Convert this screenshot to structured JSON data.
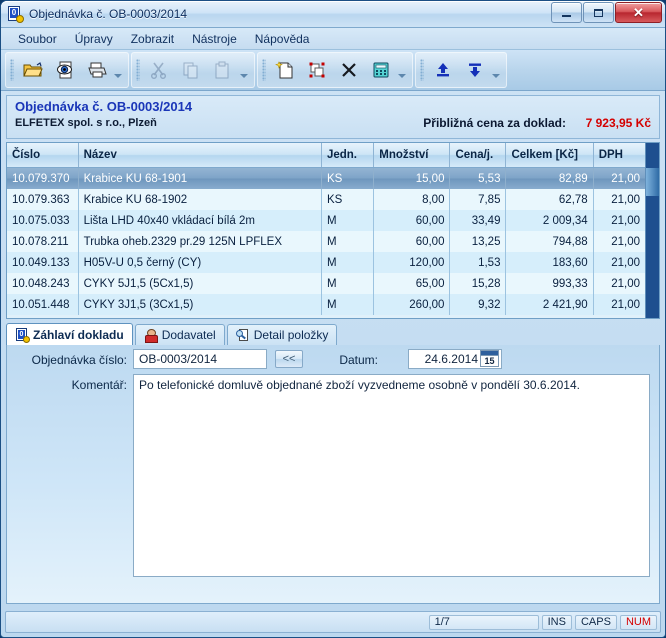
{
  "window": {
    "title": "Objednávka č. OB-0003/2014",
    "icon": "document-key-icon",
    "minimize": "–",
    "maximize": "□",
    "close": "✕"
  },
  "menu": {
    "items": [
      {
        "label": "Soubor"
      },
      {
        "label": "Úpravy"
      },
      {
        "label": "Zobrazit"
      },
      {
        "label": "Nástroje"
      },
      {
        "label": "Nápověda"
      }
    ]
  },
  "toolbar": {
    "groups": [
      {
        "buttons": [
          {
            "name": "open-icon",
            "enabled": true
          },
          {
            "name": "print-preview-icon",
            "enabled": true
          },
          {
            "name": "print-icon",
            "enabled": true
          }
        ]
      },
      {
        "buttons": [
          {
            "name": "cut-icon",
            "enabled": false
          },
          {
            "name": "copy-icon",
            "enabled": false
          },
          {
            "name": "paste-icon",
            "enabled": false
          }
        ]
      },
      {
        "buttons": [
          {
            "name": "new-record-icon",
            "enabled": true
          },
          {
            "name": "duplicate-record-icon",
            "enabled": true
          },
          {
            "name": "delete-record-icon",
            "enabled": true
          },
          {
            "name": "calculator-icon",
            "enabled": true
          }
        ]
      },
      {
        "buttons": [
          {
            "name": "move-up-icon",
            "enabled": true
          },
          {
            "name": "move-down-icon",
            "enabled": true
          }
        ]
      }
    ]
  },
  "doc_header": {
    "title": "Objednávka č. OB-0003/2014",
    "subtitle": "ELFETEX spol. s r.o., Plzeň",
    "price_label": "Přibližná cena za doklad:",
    "price_value": "7 923,95 Kč",
    "price_color": "#d40000",
    "title_color": "#1a36b8"
  },
  "grid": {
    "columns": [
      "Číslo",
      "Název",
      "Jedn.",
      "Množství",
      "Cena/j.",
      "Celkem [Kč]",
      "DPH"
    ],
    "rows": [
      {
        "cislo": "10.079.370",
        "nazev": "Krabice KU 68-1901",
        "jedn": "KS",
        "mnozstvi": "15,00",
        "cena": "5,53",
        "celkem": "82,89",
        "dph": "21,00",
        "selected": true
      },
      {
        "cislo": "10.079.363",
        "nazev": "Krabice KU 68-1902",
        "jedn": "KS",
        "mnozstvi": "8,00",
        "cena": "7,85",
        "celkem": "62,78",
        "dph": "21,00",
        "selected": false
      },
      {
        "cislo": "10.075.033",
        "nazev": "Lišta LHD 40x40 vkládací bílá 2m",
        "jedn": "M",
        "mnozstvi": "60,00",
        "cena": "33,49",
        "celkem": "2 009,34",
        "dph": "21,00",
        "selected": false
      },
      {
        "cislo": "10.078.211",
        "nazev": "Trubka oheb.2329 pr.29 125N LPFLEX",
        "jedn": "M",
        "mnozstvi": "60,00",
        "cena": "13,25",
        "celkem": "794,88",
        "dph": "21,00",
        "selected": false
      },
      {
        "cislo": "10.049.133",
        "nazev": "H05V-U 0,5 černý (CY)",
        "jedn": "M",
        "mnozstvi": "120,00",
        "cena": "1,53",
        "celkem": "183,60",
        "dph": "21,00",
        "selected": false
      },
      {
        "cislo": "10.048.243",
        "nazev": "CYKY 5J1,5 (5Cx1,5)",
        "jedn": "M",
        "mnozstvi": "65,00",
        "cena": "15,28",
        "celkem": "993,33",
        "dph": "21,00",
        "selected": false
      },
      {
        "cislo": "10.051.448",
        "nazev": "CYKY 3J1,5  (3Cx1,5)",
        "jedn": "M",
        "mnozstvi": "260,00",
        "cena": "9,32",
        "celkem": "2 421,90",
        "dph": "21,00",
        "selected": false
      }
    ]
  },
  "tabs": [
    {
      "label": "Záhlaví dokladu",
      "icon": "document-key-icon",
      "active": true
    },
    {
      "label": "Dodavatel",
      "icon": "supplier-person-icon",
      "active": false
    },
    {
      "label": "Detail položky",
      "icon": "item-detail-magnifier-icon",
      "active": false
    }
  ],
  "form": {
    "order_number_label": "Objednávka číslo:",
    "order_number_value": "OB-0003/2014",
    "prev_button_label": "<<",
    "date_label": "Datum:",
    "date_value": "24.6.2014",
    "calendar_day": "15",
    "comment_label": "Komentář:",
    "comment_value": "Po telefonické domluvě objednané zboží vyzvedneme osobně v pondělí 30.6.2014."
  },
  "statusbar": {
    "position": "1/7",
    "ins": "INS",
    "caps": "CAPS",
    "num": "NUM",
    "num_color": "#d40000"
  }
}
